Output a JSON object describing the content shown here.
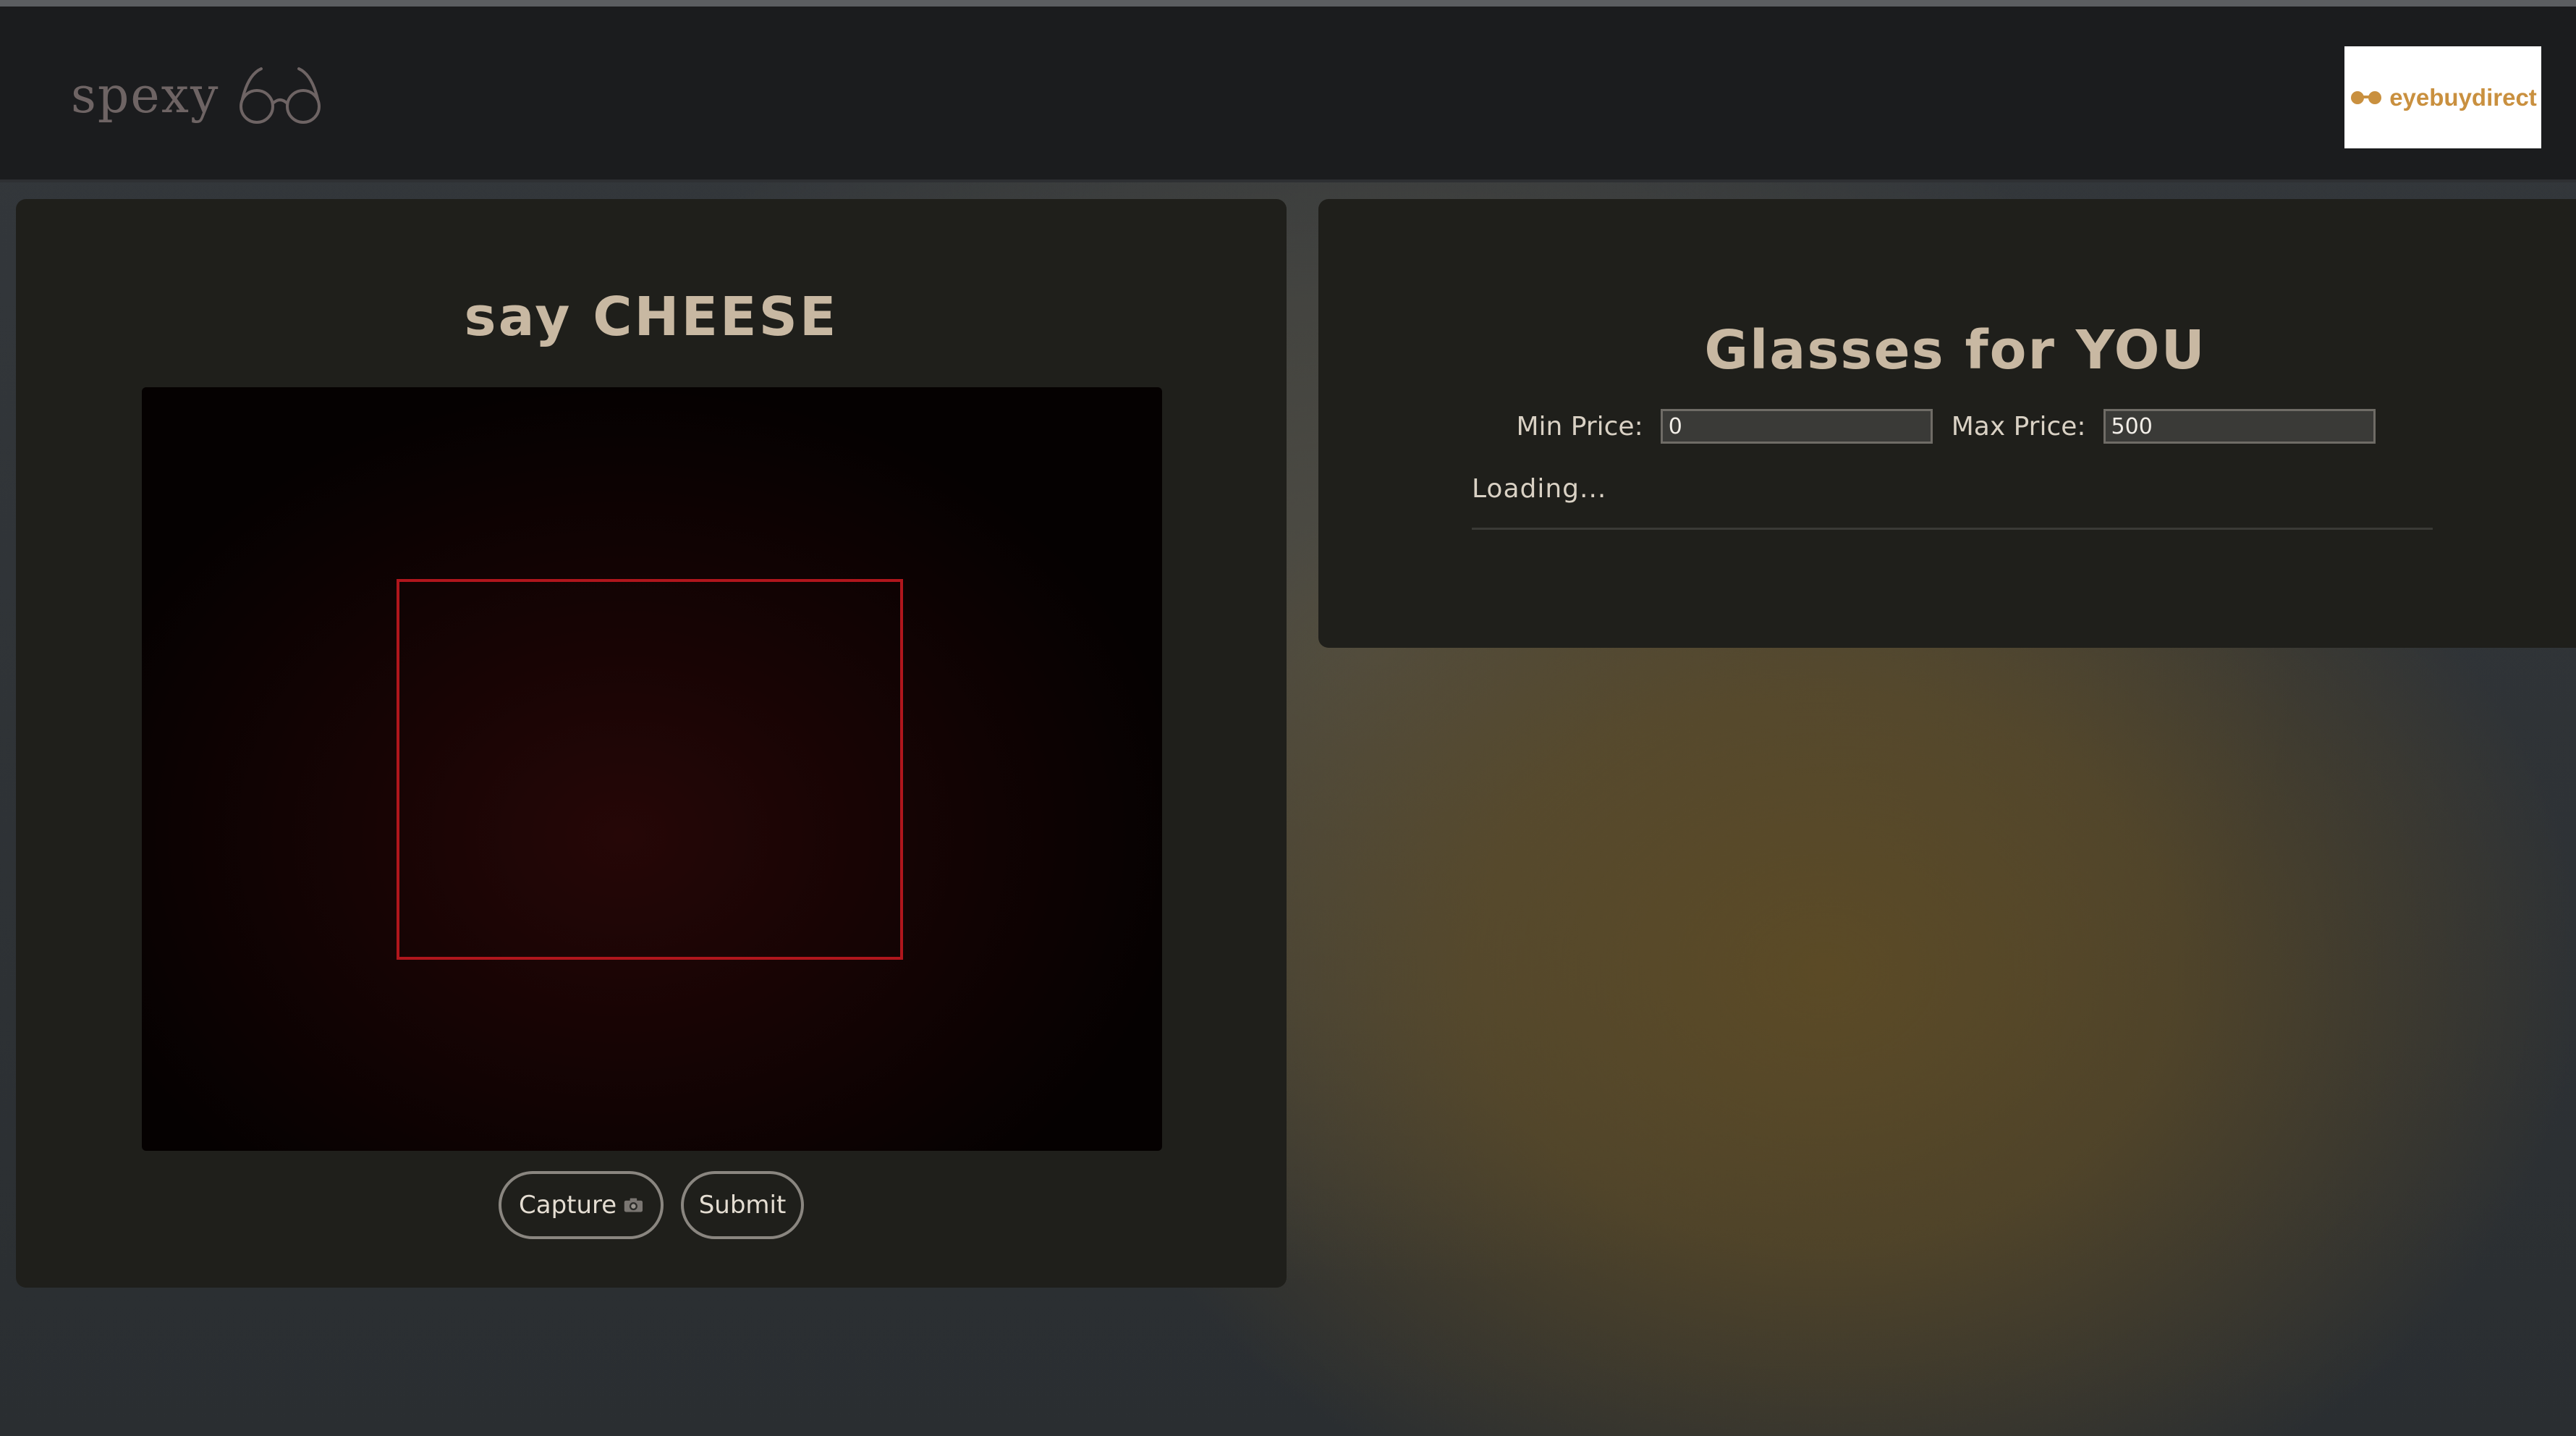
{
  "header": {
    "logo_text": "spexy",
    "logo_icon": "glasses-icon",
    "partner_logo": "eyebuydirect",
    "partner_icon": "glasses-icon"
  },
  "camera_panel": {
    "title": "say CHEESE",
    "capture_label": "Capture",
    "capture_icon": "camera-icon",
    "submit_label": "Submit"
  },
  "results_panel": {
    "title": "Glasses for YOU",
    "min_price_label": "Min Price:",
    "min_price_value": "0",
    "max_price_label": "Max Price:",
    "max_price_value": "500",
    "status": "Loading..."
  },
  "colors": {
    "frame_outline": "#b0161c",
    "title_text": "#c8b8a2",
    "partner_brand": "#c9903f"
  }
}
